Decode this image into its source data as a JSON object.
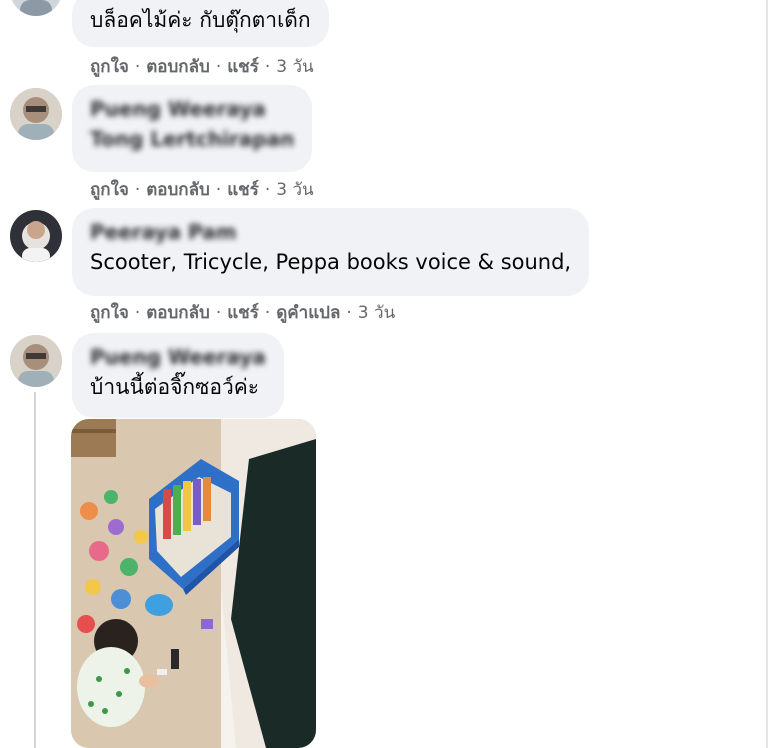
{
  "comments": [
    {
      "author": "",
      "text": "บล็อคไม้ค่ะ กับตุ๊กตาเด็ก",
      "actions": [
        "ถูกใจ",
        "ตอบกลับ",
        "แชร์"
      ],
      "time": "3 วัน"
    },
    {
      "author": "Pueng Weeraya",
      "text": "Tong Lertchirapan",
      "actions": [
        "ถูกใจ",
        "ตอบกลับ",
        "แชร์"
      ],
      "time": "3 วัน"
    },
    {
      "author": "Peeraya Pam",
      "text": "Scooter, Tricycle, Peppa books voice & sound,",
      "actions": [
        "ถูกใจ",
        "ตอบกลับ",
        "แชร์",
        "ดูคำแปล"
      ],
      "time": "3 วัน"
    },
    {
      "author": "Pueng Weeraya",
      "text": "บ้านนี้ต่อจิ๊กซอว์ค่ะ"
    }
  ],
  "colors": {
    "bubble": "#f0f2f5",
    "meta": "#65676b",
    "text": "#050505"
  }
}
